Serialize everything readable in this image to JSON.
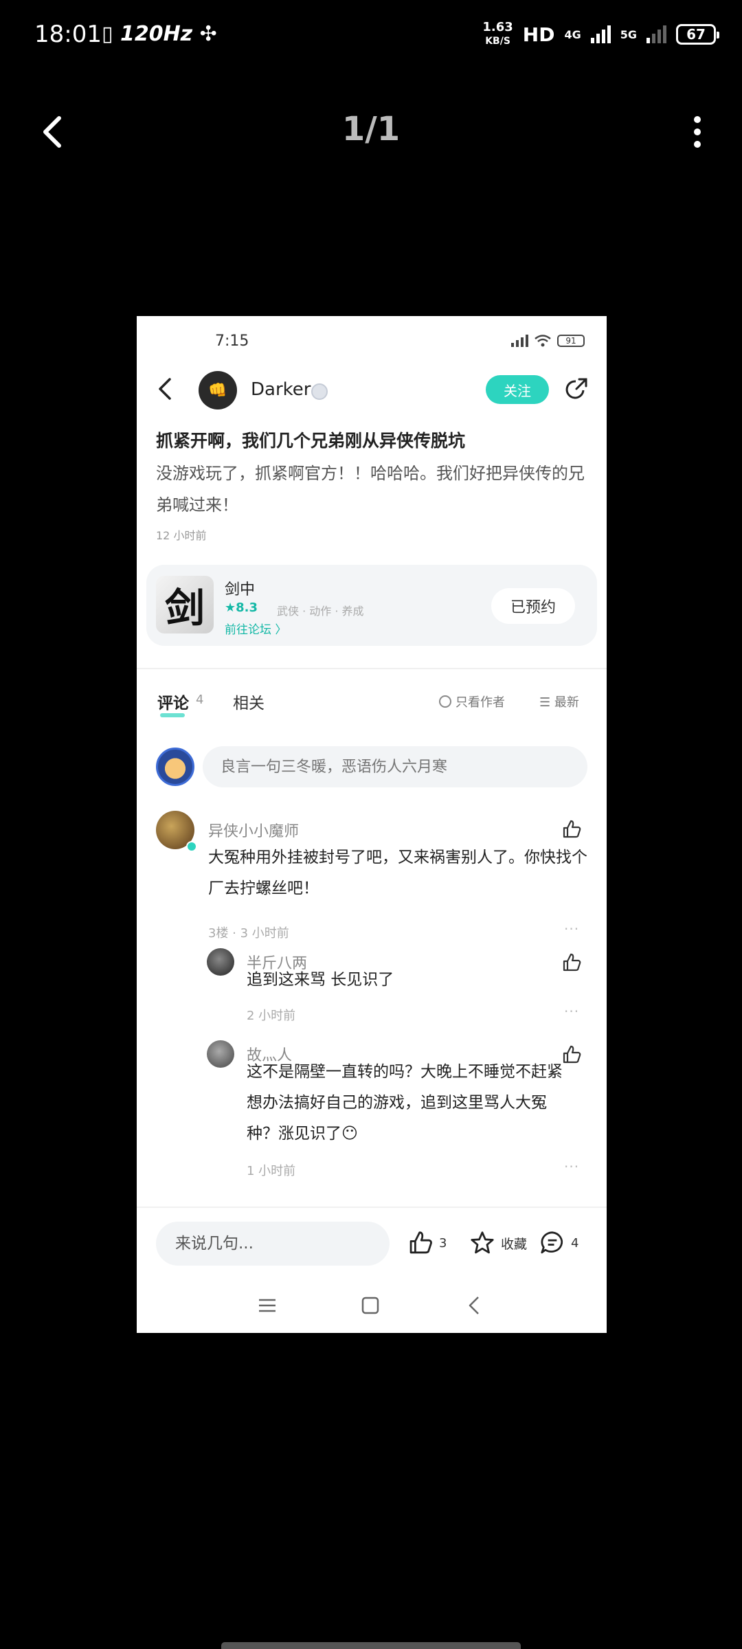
{
  "status_bar": {
    "time": "18:01",
    "left_icons": "▯ 120Hz ✣",
    "speed_value": "1.63",
    "speed_unit": "KB/S",
    "hd": "HD",
    "net_4g": "4G",
    "net_5g": "5G",
    "battery": "67"
  },
  "viewer": {
    "page_counter": "1/1",
    "back_icon": "chevron-left-icon",
    "more_icon": "more-vertical-icon"
  },
  "screenshot": {
    "status": {
      "time": "7:15",
      "battery": "91"
    },
    "header": {
      "author_name": "Darker",
      "avatar_emoji": "👊",
      "follow_label": "关注"
    },
    "post": {
      "title": "抓紧开啊，我们几个兄弟刚从异侠传脱坑",
      "body": "没游戏玩了，抓紧啊官方！！哈哈哈。我们好把异侠传的兄弟喊过来！",
      "time": "12 小时前"
    },
    "game_card": {
      "icon_char": "剑",
      "name": "剑中",
      "rating": "★8.3",
      "tags": "武侠 · 动作 · 养成",
      "link": "前往论坛 〉",
      "button": "已预约"
    },
    "tabs": {
      "comments_label": "评论",
      "comments_count": "4",
      "related_label": "相关",
      "author_only": "只看作者",
      "sort": "☰ 最新"
    },
    "comment_placeholder": "良言一句三冬暖，恶语伤人六月寒",
    "comments": [
      {
        "name": "异侠小小魔师",
        "text": "大冤种用外挂被封号了吧，又来祸害别人了。你快找个厂去拧螺丝吧！",
        "meta": "3楼 · 3 小时前"
      },
      {
        "name": "半斤八两",
        "text": "追到这来骂 长见识了",
        "meta": "2 小时前"
      },
      {
        "name": "故灬人",
        "text": "这不是隔壁一直转的吗？大晚上不睡觉不赶紧想办法搞好自己的游戏，追到这里骂人大冤种？涨见识了😶",
        "meta": "1 小时前"
      }
    ],
    "bottom_bar": {
      "input_placeholder": "来说几句...",
      "like_count": "3",
      "fav_label": "收藏",
      "comment_count": "4"
    },
    "colors": {
      "accent": "#2dd4bf",
      "accent_text": "#14b8a6"
    }
  }
}
